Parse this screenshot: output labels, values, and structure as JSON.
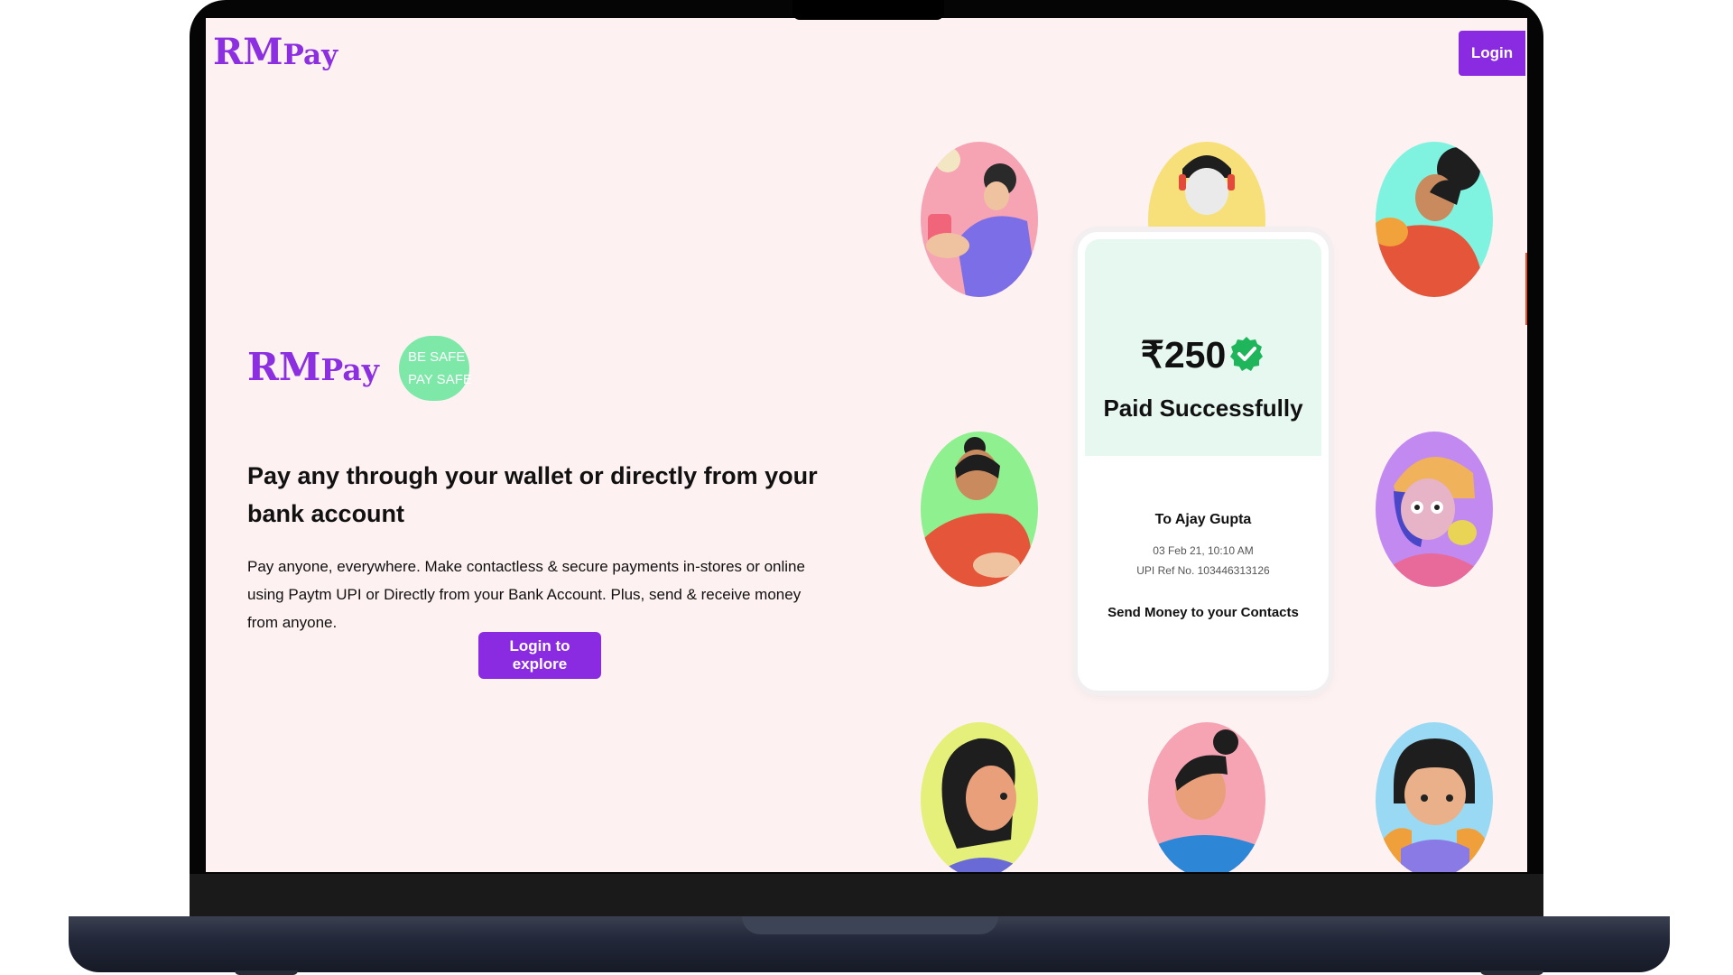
{
  "navbar": {
    "logo_rm": "RM",
    "logo_pay": "Pay",
    "login_label": "Login"
  },
  "hero": {
    "logo_rm": "RM",
    "logo_pay": "Pay",
    "tagline_line1": "BE SAFE",
    "tagline_line2": "PAY SAFE",
    "headline": "Pay any through your wallet or directly from your bank account",
    "description": "Pay anyone, everywhere. Make contactless & secure payments in-stores or online using Paytm UPI or Directly from your Bank Account. Plus, send & receive money from anyone.",
    "cta_label": "Login to explore"
  },
  "payment_card": {
    "amount": "₹250",
    "status": "Paid Successfully",
    "recipient": "To Ajay Gupta",
    "date": "03 Feb 21, 10:10 AM",
    "upi_ref": "UPI Ref No. 103446313126",
    "action": "Send Money to your Contacts"
  },
  "colors": {
    "brand": "#8b2fe0",
    "button": "#8a2be2",
    "page_bg": "#fdf1f1",
    "badge": "#7de8a8",
    "success": "#1fb55a",
    "card_top": "#e6f8f0"
  },
  "icons": [
    "verified-check-icon"
  ]
}
